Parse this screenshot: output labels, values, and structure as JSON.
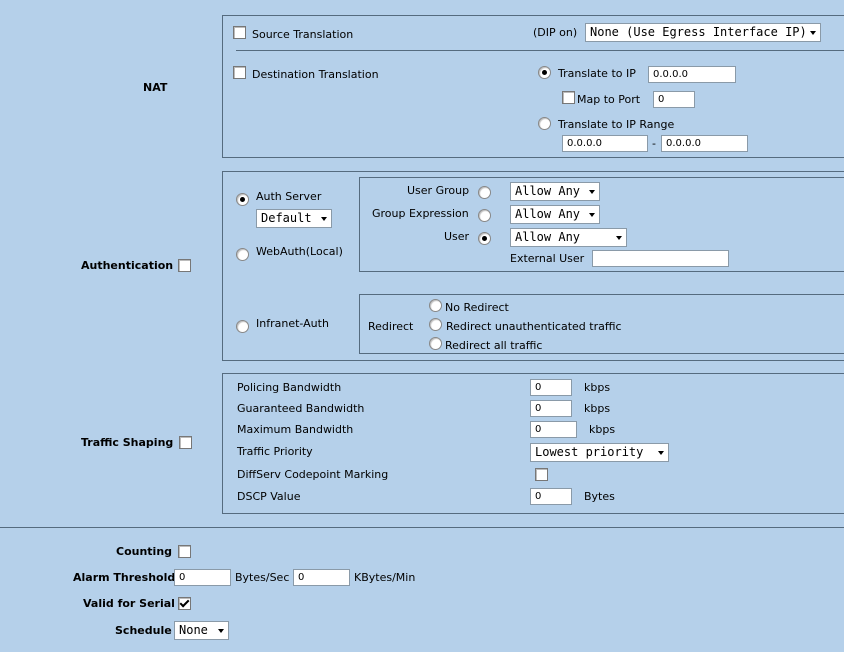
{
  "nat": {
    "label": "NAT",
    "source_translation": "Source Translation",
    "dip_on": "(DIP on)",
    "dip_select": "None (Use Egress Interface IP)",
    "destination_translation": "Destination Translation",
    "translate_to_ip": "Translate to IP",
    "translate_ip_value": "0.0.0.0",
    "map_to_port": "Map to Port",
    "map_port_value": "0",
    "translate_to_ip_range": "Translate to IP Range",
    "range_start": "0.0.0.0",
    "range_sep": "-",
    "range_end": "0.0.0.0"
  },
  "auth": {
    "label": "Authentication",
    "auth_server": "Auth Server",
    "auth_server_select": "Default",
    "webauth_local": "WebAuth(Local)",
    "infranet_auth": "Infranet-Auth",
    "user_group": "User Group",
    "user_group_select": "Allow Any",
    "group_expression": "Group Expression",
    "group_expression_select": "Allow Any",
    "user": "User",
    "user_select": "Allow Any",
    "external_user": "External User",
    "external_user_value": "",
    "redirect": "Redirect",
    "no_redirect": "No Redirect",
    "redirect_unauth": "Redirect unauthenticated traffic",
    "redirect_all": "Redirect all traffic"
  },
  "shaping": {
    "label": "Traffic Shaping",
    "policing_bandwidth": "Policing Bandwidth",
    "policing_value": "0",
    "guaranteed_bandwidth": "Guaranteed Bandwidth",
    "guaranteed_value": "0",
    "maximum_bandwidth": "Maximum Bandwidth",
    "maximum_value": "0",
    "kbps": "kbps",
    "traffic_priority": "Traffic Priority",
    "priority_select": "Lowest priority",
    "diffserv": "DiffServ Codepoint Marking",
    "dscp_value": "DSCP Value",
    "dscp_input": "0",
    "bytes": "Bytes"
  },
  "misc": {
    "counting": "Counting",
    "alarm_threshold": "Alarm Threshold",
    "alarm_bytes_value": "0",
    "bytes_sec": "Bytes/Sec",
    "alarm_kbytes_value": "0",
    "kbytes_min": "KBytes/Min",
    "valid_for_serial": "Valid for Serial",
    "schedule": "Schedule",
    "schedule_select": "None"
  },
  "colors": {
    "background": "#b5d0ea",
    "border": "#556b7f"
  }
}
